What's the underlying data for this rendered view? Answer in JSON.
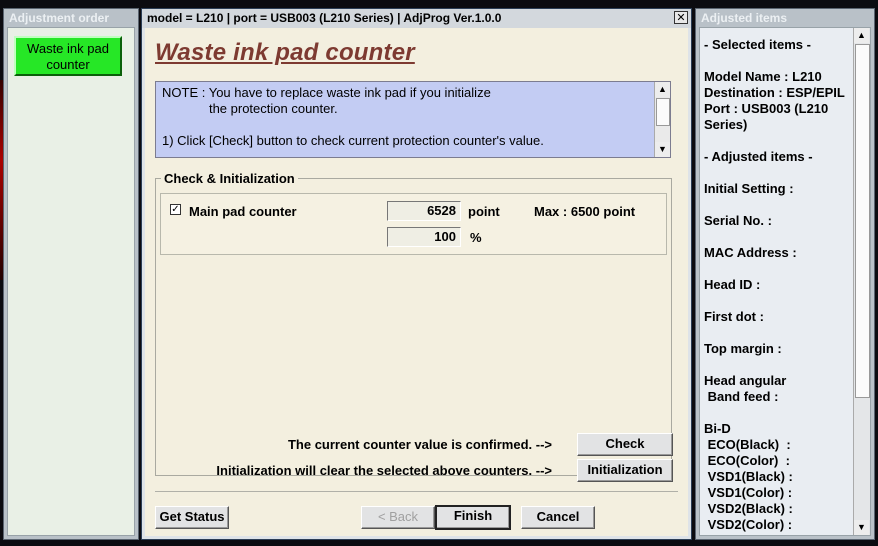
{
  "left_panel": {
    "title": "Adjustment order",
    "item_line1": "Waste ink pad",
    "item_line2": "counter"
  },
  "main_window": {
    "title": "model = L210 | port = USB003 (L210 Series) | AdjProg Ver.1.0.0",
    "close_glyph": "✕",
    "heading": "Waste ink pad counter",
    "note": [
      "NOTE : You have to replace waste ink pad if you initialize",
      "             the protection counter.",
      "",
      "1) Click [Check] button to check current protection counter's value."
    ],
    "group_label": "Check & Initialization",
    "counter": {
      "checked": true,
      "check_glyph": "✓",
      "label": "Main pad counter",
      "value": "6528",
      "unit": "point",
      "max_label": "Max : 6500 point",
      "percent": "100",
      "percent_unit": "%"
    },
    "confirm_text": "The current counter value is confirmed. -->",
    "init_text": "Initialization will clear the selected above counters. -->",
    "check_button": "Check",
    "init_button": "Initialization",
    "get_status_button": "Get Status",
    "back_button": "< Back",
    "finish_button": "Finish",
    "cancel_button": "Cancel"
  },
  "right_panel": {
    "title": "Adjusted items",
    "lines": [
      "- Selected items -",
      "",
      "Model Name : L210",
      "Destination : ESP/EPIL",
      "Port : USB003 (L210",
      "Series)",
      "",
      "- Adjusted items -",
      "",
      "Initial Setting :",
      "",
      "Serial No. :",
      "",
      "MAC Address :",
      "",
      "Head ID :",
      "",
      "First dot :",
      "",
      "Top margin :",
      "",
      "Head angular",
      " Band feed :",
      "",
      "Bi-D",
      " ECO(Black)  :",
      " ECO(Color)  :",
      " VSD1(Black) :",
      " VSD1(Color) :",
      " VSD2(Black) :",
      " VSD2(Color) :"
    ]
  },
  "scroll_arrows": {
    "up": "▲",
    "down": "▼"
  },
  "colors": {
    "heading": "#7d3a31",
    "note_bg": "#c3ccf3",
    "active_item": "#26e726",
    "panel_bg": "#f3efdf"
  }
}
